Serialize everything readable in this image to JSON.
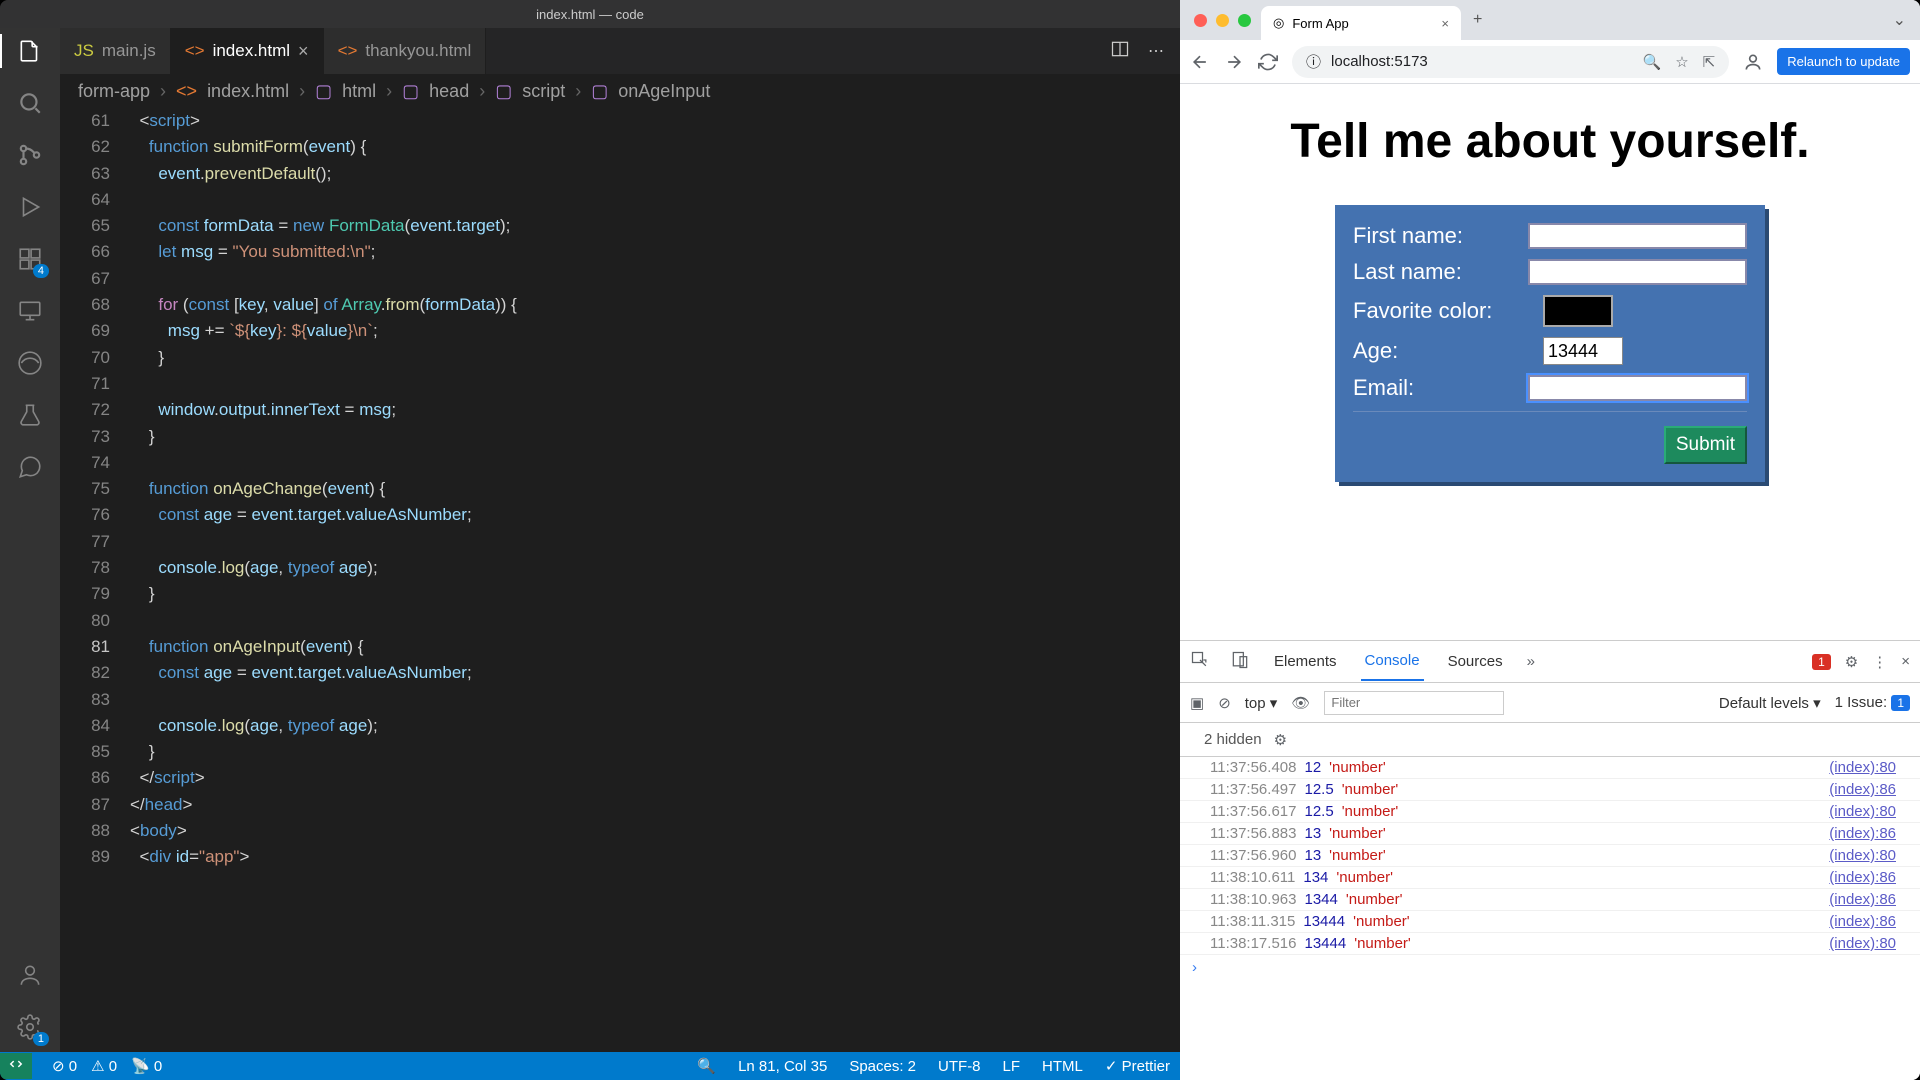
{
  "vscode": {
    "title": "index.html — code",
    "tabs": [
      {
        "label": "main.js",
        "icon": "JS"
      },
      {
        "label": "index.html",
        "icon": "<>"
      },
      {
        "label": "thankyou.html",
        "icon": "<>"
      }
    ],
    "activeTab": 1,
    "breadcrumb": [
      "form-app",
      "index.html",
      "html",
      "head",
      "script",
      "onAgeInput"
    ],
    "badges": {
      "extensions": "4",
      "settings": "1"
    },
    "lineStart": 61,
    "currentLine": 81,
    "statusbar": {
      "errors": "0",
      "warnings": "0",
      "ports": "0",
      "cursor": "Ln 81, Col 35",
      "spaces": "Spaces: 2",
      "encoding": "UTF-8",
      "eol": "LF",
      "lang": "HTML",
      "format": "Prettier"
    }
  },
  "browser": {
    "tabTitle": "Form App",
    "url": "localhost:5173",
    "relaunch": "Relaunch to update",
    "page": {
      "heading": "Tell me about yourself.",
      "labels": {
        "first": "First name:",
        "last": "Last name:",
        "color": "Favorite color:",
        "age": "Age:",
        "email": "Email:"
      },
      "ageValue": "13444",
      "submit": "Submit"
    }
  },
  "devtools": {
    "tabs": [
      "Elements",
      "Console",
      "Sources"
    ],
    "activeTab": "Console",
    "errorCount": "1",
    "context": "top",
    "filterPlaceholder": "Filter",
    "levels": "Default levels",
    "issue": "1 Issue:",
    "issueCount": "1",
    "hidden": "2 hidden",
    "logs": [
      {
        "ts": "11:37:56.408",
        "val": "12",
        "type": "'number'",
        "src": "(index):80"
      },
      {
        "ts": "11:37:56.497",
        "val": "12.5",
        "type": "'number'",
        "src": "(index):86"
      },
      {
        "ts": "11:37:56.617",
        "val": "12.5",
        "type": "'number'",
        "src": "(index):80"
      },
      {
        "ts": "11:37:56.883",
        "val": "13",
        "type": "'number'",
        "src": "(index):86"
      },
      {
        "ts": "11:37:56.960",
        "val": "13",
        "type": "'number'",
        "src": "(index):80"
      },
      {
        "ts": "11:38:10.611",
        "val": "134",
        "type": "'number'",
        "src": "(index):86"
      },
      {
        "ts": "11:38:10.963",
        "val": "1344",
        "type": "'number'",
        "src": "(index):86"
      },
      {
        "ts": "11:38:11.315",
        "val": "13444",
        "type": "'number'",
        "src": "(index):86"
      },
      {
        "ts": "11:38:17.516",
        "val": "13444",
        "type": "'number'",
        "src": "(index):80"
      }
    ]
  }
}
